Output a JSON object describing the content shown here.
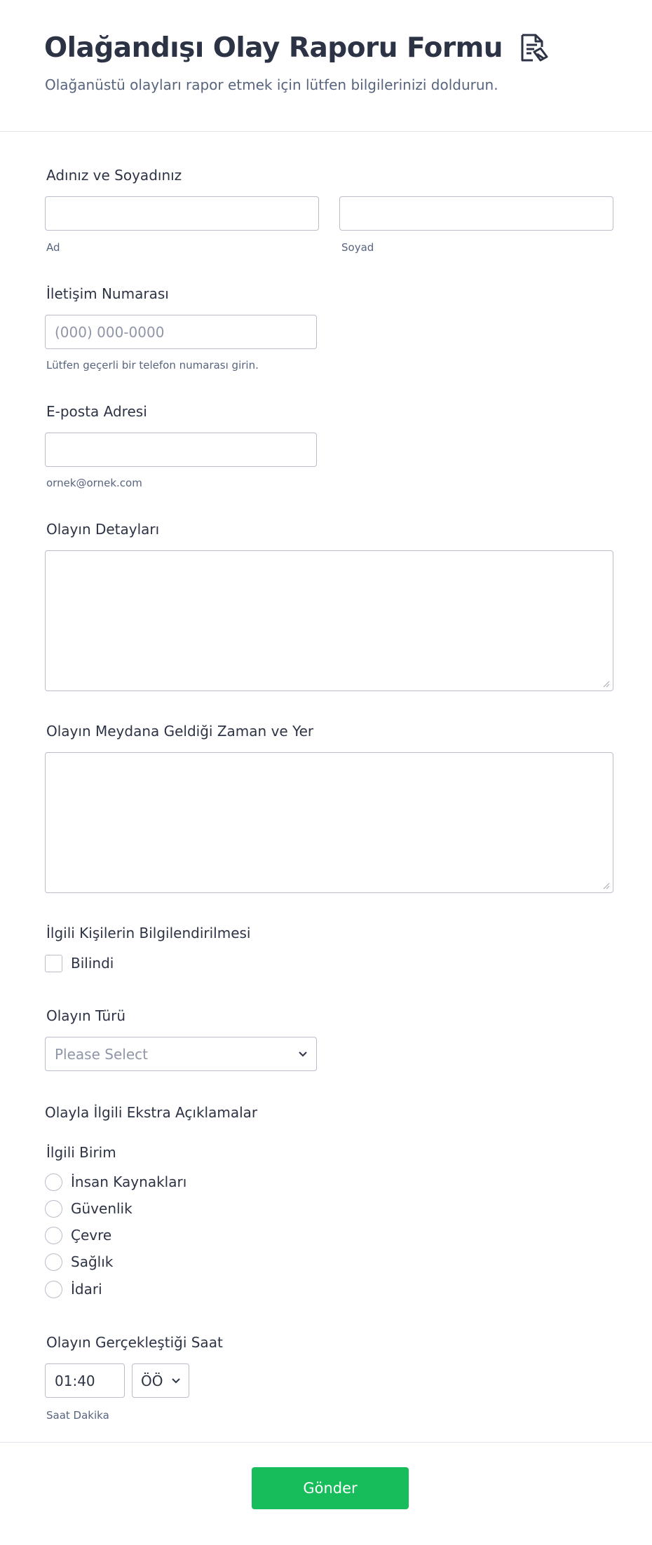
{
  "header": {
    "title": "Olağandışı Olay Raporu Formu",
    "title_icon": "document-pen-icon",
    "subtitle": "Olağanüstü olayları rapor etmek için lütfen bilgilerinizi doldurun."
  },
  "fields": {
    "name": {
      "label": "Adınız ve Soyadınız",
      "first_sublabel": "Ad",
      "last_sublabel": "Soyad",
      "first_value": "",
      "last_value": ""
    },
    "phone": {
      "label": "İletişim Numarası",
      "placeholder": "(000) 000-0000",
      "sublabel": "Lütfen geçerli bir telefon numarası girin."
    },
    "email": {
      "label": "E-posta Adresi",
      "value": "",
      "sublabel": "ornek@ornek.com"
    },
    "details": {
      "label": "Olayın Detayları"
    },
    "time_place": {
      "label": "Olayın Meydana Geldiği Zaman ve Yer"
    },
    "informed": {
      "label": "İlgili Kişilerin Bilgilendirilmesi",
      "option": "Bilindi"
    },
    "type": {
      "label": "Olayın Türü",
      "placeholder": "Please Select"
    },
    "extra_text": "Olayla İlgili Ekstra Açıklamalar",
    "department": {
      "label": "İlgili Birim",
      "options": [
        "İnsan Kaynakları",
        "Güvenlik",
        "Çevre",
        "Sağlık",
        "İdari"
      ]
    },
    "time": {
      "label": "Olayın Gerçekleştiği Saat",
      "value": "01:40",
      "ampm": "ÖÖ",
      "sublabel": "Saat Dakika"
    }
  },
  "submit": {
    "label": "Gönder"
  },
  "colors": {
    "accent": "#18bd5b",
    "text": "#2c3345",
    "muted": "#57647e",
    "border": "#b8bdc9"
  }
}
